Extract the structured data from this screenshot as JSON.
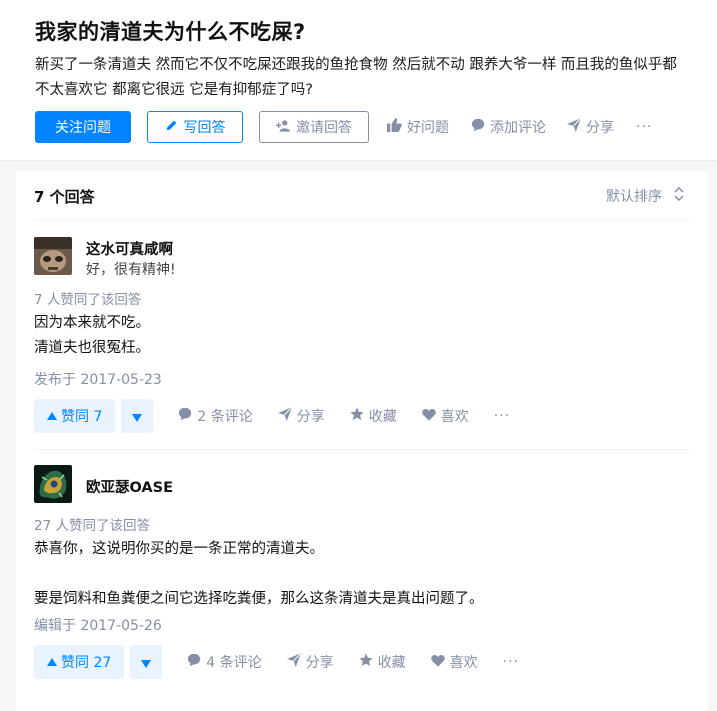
{
  "question": {
    "title": "我家的清道夫为什么不吃屎?",
    "detail_lines": [
      "新买了一条清道夫 然而它不仅不吃屎还跟我的鱼抢食物 然后就不动 跟养大爷一样 而且我的鱼似乎都",
      "不太喜欢它 都离它很远 它是有抑郁症了吗?"
    ],
    "buttons": {
      "follow": "关注问题",
      "write": "写回答",
      "invite": "邀请回答"
    },
    "actions": {
      "good_question": "好问题",
      "add_comment": "添加评论",
      "share": "分享",
      "more": "···"
    }
  },
  "answers_header": {
    "count": "7 个回答",
    "sort": "默认排序"
  },
  "answers": [
    {
      "author": "这水可真咸啊",
      "bio": "好，很有精神!",
      "voters": "7 人赞同了该回答",
      "content": [
        "因为本来就不吃。",
        "清道夫也很冤枉。"
      ],
      "time": "发布于 2017-05-23",
      "vote_label": "赞同 7",
      "comments": "2 条评论",
      "share": "分享",
      "collect": "收藏",
      "like": "喜欢",
      "more": "···"
    },
    {
      "author": "欧亚瑟OASE",
      "bio": "",
      "voters": "27 人赞同了该回答",
      "content": [
        "恭喜你，这说明你买的是一条正常的清道夫。",
        "",
        "要是饲料和鱼粪便之间它选择吃粪便，那么这条清道夫是真出问题了。"
      ],
      "time": "编辑于 2017-05-26",
      "vote_label": "赞同 27",
      "comments": "4 条评论",
      "share": "分享",
      "collect": "收藏",
      "like": "喜欢",
      "more": "···"
    }
  ],
  "colors": {
    "brand": "#0084ff",
    "muted": "#8590a6",
    "vote_bg": "#e8f3ff"
  }
}
